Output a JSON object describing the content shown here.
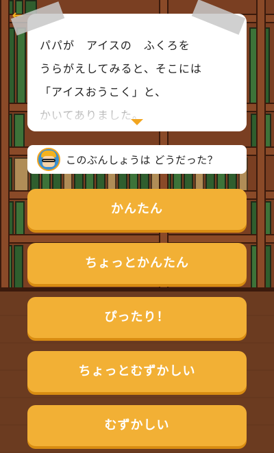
{
  "story": {
    "lines": [
      "パパが　アイスの　ふくろを",
      "うらがえしてみると、そこには",
      "「アイスおうこく」と、",
      "かいてありました。"
    ]
  },
  "question": {
    "text": "このぶんしょうは どうだった？"
  },
  "answers": [
    {
      "label": "かんたん"
    },
    {
      "label": "ちょっとかんたん"
    },
    {
      "label": "ぴったり！"
    },
    {
      "label": "ちょっとむずかしい"
    },
    {
      "label": "むずかしい"
    }
  ],
  "icons": {
    "back": "back-arrow-icon",
    "more": "scroll-more-icon",
    "avatar": "character-avatar"
  },
  "colors": {
    "accent": "#f2b035",
    "accent_shadow": "#d88c12",
    "back_arrow": "#f2b21f"
  }
}
